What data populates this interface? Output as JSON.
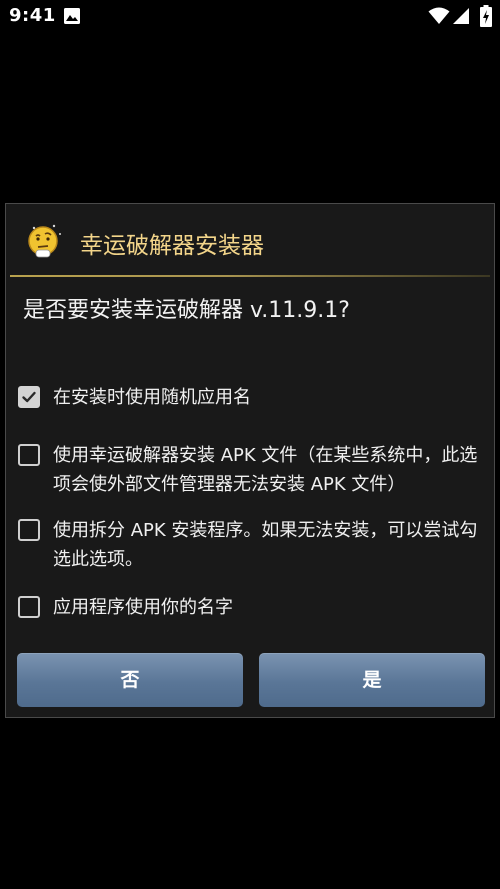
{
  "status_bar": {
    "time": "9:41",
    "icons": [
      "photo-icon",
      "wifi-icon",
      "signal-icon",
      "battery-icon"
    ]
  },
  "dialog": {
    "title": "幸运破解器安装器",
    "app_icon": "thinking-face-icon",
    "question": "是否要安装幸运破解器 v.11.9.1?",
    "options": [
      {
        "label": "在安装时使用随机应用名",
        "checked": true
      },
      {
        "label": "使用幸运破解器安装 APK 文件（在某些系统中，此选项会使外部文件管理器无法安装 APK 文件）",
        "checked": false
      },
      {
        "label": "使用拆分 APK 安装程序。如果无法安装，可以尝试勾选此选项。",
        "checked": false
      },
      {
        "label": "应用程序使用你的名字",
        "checked": false
      }
    ],
    "buttons": {
      "no_label": "否",
      "yes_label": "是"
    }
  },
  "colors": {
    "background": "#000000",
    "dialog_background": "#191919",
    "title_color": "#f3d58a",
    "divider_accent": "#b9a24e",
    "button_top": "#7b94b1",
    "button_bottom": "#4f6b8c"
  }
}
